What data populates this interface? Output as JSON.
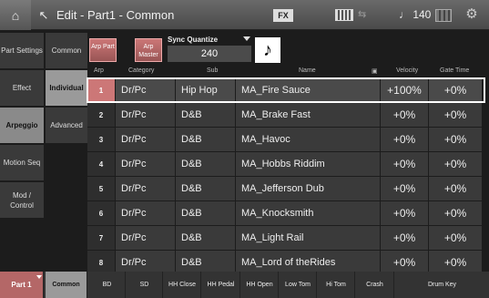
{
  "title": "Edit - Part1 - Common",
  "status": {
    "fx": "FX",
    "tempo": "♩ 140"
  },
  "left_nav": [
    "Part Settings",
    "Effect",
    "Arpeggio",
    "Motion Seq",
    "Mod / Control"
  ],
  "mid_nav": [
    "Common",
    "Individual",
    "Advanced"
  ],
  "arp_buttons": [
    "Arp Part",
    "Arp Master"
  ],
  "sync_quantize": {
    "label": "Sync Quantize",
    "value": "240"
  },
  "headers": {
    "arp": "Arp",
    "category": "Category",
    "sub": "Sub",
    "name": "Name",
    "velocity": "Velocity",
    "gate": "Gate Time"
  },
  "rows": [
    {
      "num": "1",
      "category": "Dr/Pc",
      "sub": "Hip Hop",
      "name": "MA_Fire Sauce",
      "velocity": "+100%",
      "gate": "+0%"
    },
    {
      "num": "2",
      "category": "Dr/Pc",
      "sub": "D&B",
      "name": "MA_Brake Fast",
      "velocity": "+0%",
      "gate": "+0%"
    },
    {
      "num": "3",
      "category": "Dr/Pc",
      "sub": "D&B",
      "name": "MA_Havoc",
      "velocity": "+0%",
      "gate": "+0%"
    },
    {
      "num": "4",
      "category": "Dr/Pc",
      "sub": "D&B",
      "name": "MA_Hobbs Riddim",
      "velocity": "+0%",
      "gate": "+0%"
    },
    {
      "num": "5",
      "category": "Dr/Pc",
      "sub": "D&B",
      "name": "MA_Jefferson Dub",
      "velocity": "+0%",
      "gate": "+0%"
    },
    {
      "num": "6",
      "category": "Dr/Pc",
      "sub": "D&B",
      "name": "MA_Knocksmith",
      "velocity": "+0%",
      "gate": "+0%"
    },
    {
      "num": "7",
      "category": "Dr/Pc",
      "sub": "D&B",
      "name": "MA_Light Rail",
      "velocity": "+0%",
      "gate": "+0%"
    },
    {
      "num": "8",
      "category": "Dr/Pc",
      "sub": "D&B",
      "name": "MA_Lord of theRides",
      "velocity": "+0%",
      "gate": "+0%"
    }
  ],
  "bottom": {
    "part": "Part 1",
    "common": "Common",
    "keys": [
      "BD",
      "SD",
      "HH Close",
      "HH Pedal",
      "HH Open",
      "Low Tom",
      "Hi Tom",
      "Crash",
      "Drum Key"
    ]
  }
}
